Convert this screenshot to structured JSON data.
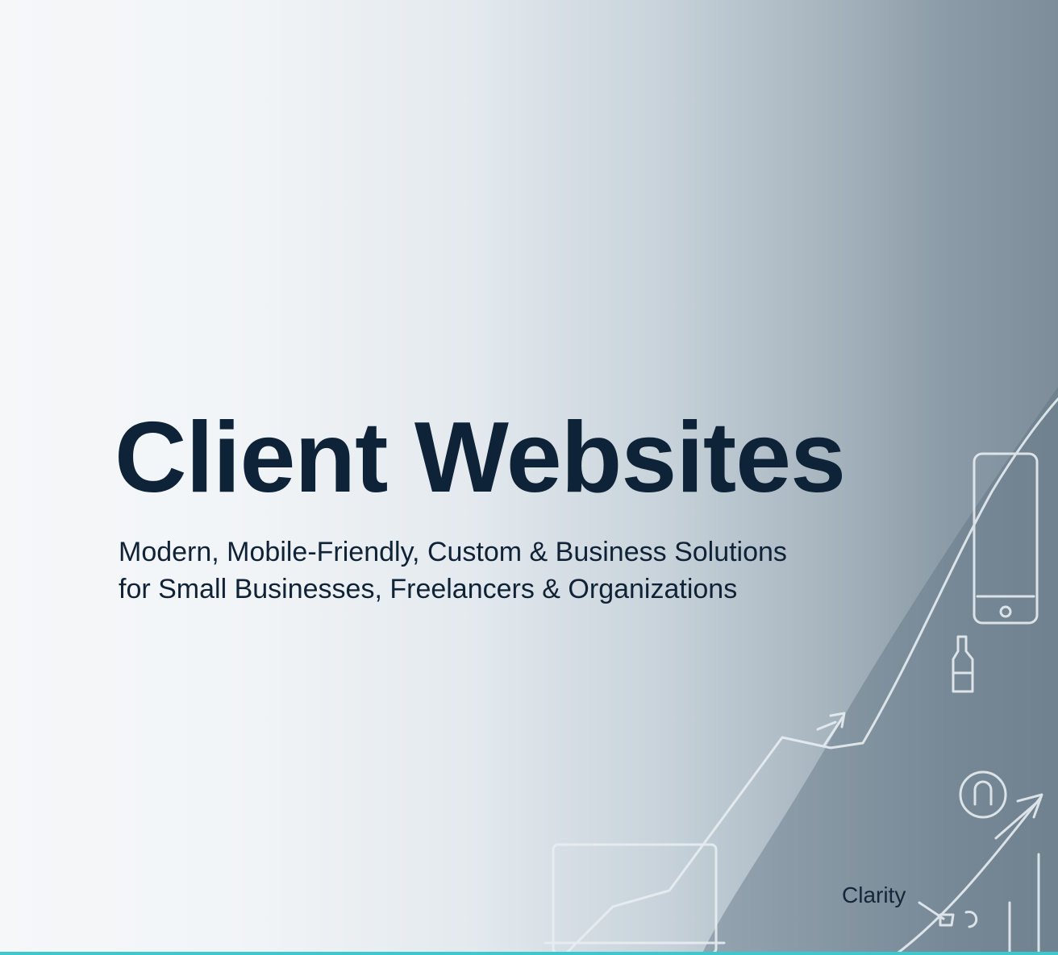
{
  "hero": {
    "title": "Client Websites",
    "subtitle_line1": "Modern, Mobile-Friendly, Custom & Business Solutions",
    "subtitle_line2": "for Small Businesses, Freelancers & Organizations"
  },
  "illustration": {
    "label": "Clarity",
    "icons": [
      "laptop-icon",
      "smartphone-icon",
      "growth-arrow-icon",
      "bottle-icon",
      "circle-badge-icon"
    ]
  },
  "colors": {
    "title": "#0e2338",
    "accent_bar": "#3ec7cc",
    "sketch_line": "#e8eef2"
  }
}
